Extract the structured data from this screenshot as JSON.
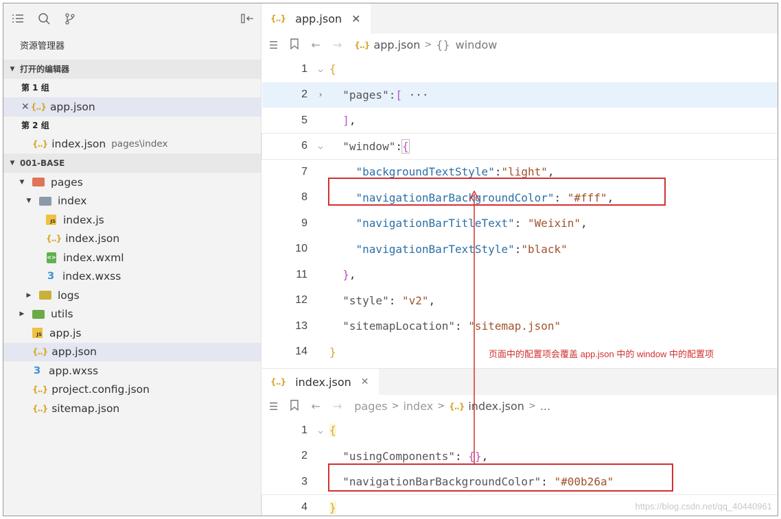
{
  "sidebar": {
    "title": "资源管理器",
    "open_editors_label": "打开的编辑器",
    "group1": "第 1 组",
    "group1_file": "app.json",
    "group2": "第 2 组",
    "group2_file": "index.json",
    "group2_path": "pages\\index",
    "project_label": "001-BASE",
    "tree": {
      "pages": "pages",
      "index": "index",
      "index_js": "index.js",
      "index_json": "index.json",
      "index_wxml": "index.wxml",
      "index_wxss": "index.wxss",
      "logs": "logs",
      "utils": "utils",
      "app_js": "app.js",
      "app_json": "app.json",
      "app_wxss": "app.wxss",
      "project_config": "project.config.json",
      "sitemap": "sitemap.json"
    }
  },
  "top_editor": {
    "tab": "app.json",
    "crumb_file": "app.json",
    "crumb_symbol": "window",
    "lines": [
      {
        "n": "1"
      },
      {
        "n": "2"
      },
      {
        "n": "5"
      },
      {
        "n": "6"
      },
      {
        "n": "7"
      },
      {
        "n": "8"
      },
      {
        "n": "9"
      },
      {
        "n": "10"
      },
      {
        "n": "11"
      },
      {
        "n": "12"
      },
      {
        "n": "13"
      },
      {
        "n": "14"
      }
    ],
    "code": {
      "pages_key": "\"pages\"",
      "window_key": "\"window\"",
      "bts_key": "\"backgroundTextStyle\"",
      "bts_val": "\"light\"",
      "nbbc_key": "\"navigationBarBackgroundColor\"",
      "nbbc_val": "\"#fff\"",
      "nbtt_key": "\"navigationBarTitleText\"",
      "nbtt_val": "\"Weixin\"",
      "nbts_key": "\"navigationBarTextStyle\"",
      "nbts_val": "\"black\"",
      "style_key": "\"style\"",
      "style_val": "\"v2\"",
      "sitemap_key": "\"sitemapLocation\"",
      "sitemap_val": "\"sitemap.json\""
    }
  },
  "bottom_editor": {
    "tab": "index.json",
    "crumb_pages": "pages",
    "crumb_index": "index",
    "crumb_file": "index.json",
    "crumb_more": "...",
    "lines": [
      {
        "n": "1"
      },
      {
        "n": "2"
      },
      {
        "n": "3"
      },
      {
        "n": "4"
      }
    ],
    "code": {
      "uc_key": "\"usingComponents\"",
      "nbbc_key": "\"navigationBarBackgroundColor\"",
      "nbbc_val": "\"#00b26a\""
    }
  },
  "annotation": "页面中的配置项会覆盖 app.json 中的 window 中的配置项",
  "watermark": "https://blog.csdn.net/qq_40440961",
  "colors": {
    "annotation": "#d32f2f",
    "selection": "#e4e6f1"
  }
}
